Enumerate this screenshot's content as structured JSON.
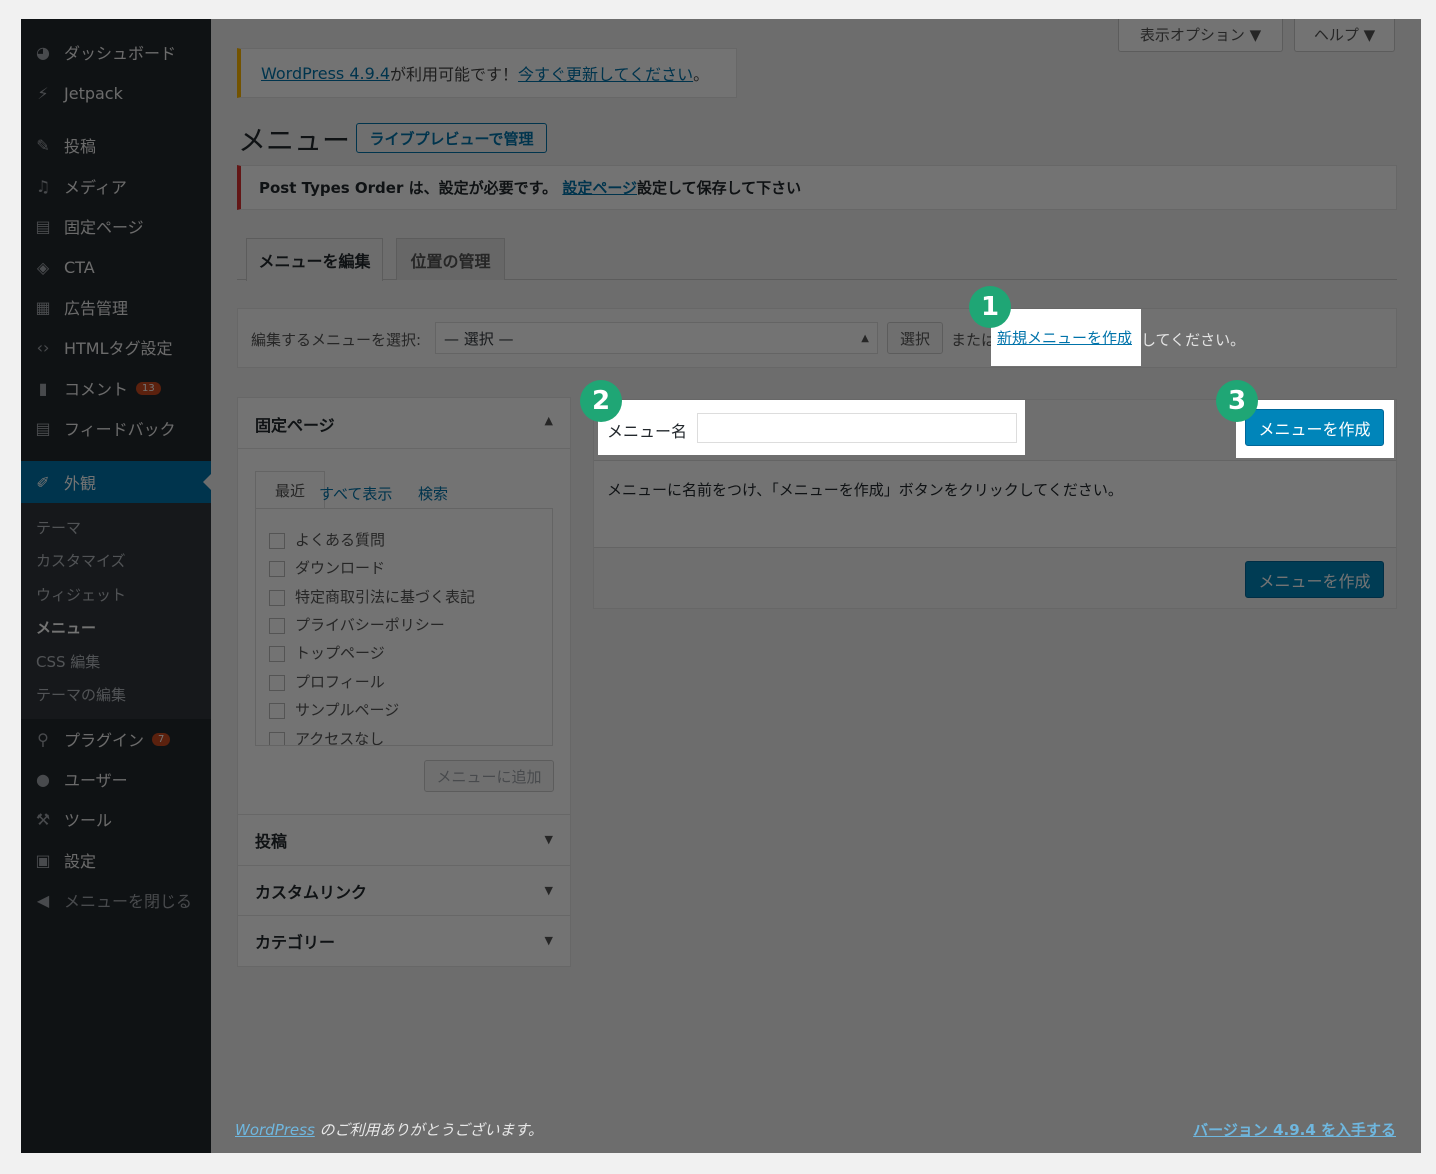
{
  "sidebar": {
    "dashboard": "ダッシュボード",
    "jetpack": "Jetpack",
    "posts": "投稿",
    "media": "メディア",
    "pages": "固定ページ",
    "cta": "CTA",
    "ads": "広告管理",
    "html_tags": "HTMLタグ設定",
    "comments": "コメント",
    "comments_count": "13",
    "feedback": "フィードバック",
    "appearance": "外観",
    "appearance_sub": {
      "themes": "テーマ",
      "customize": "カスタマイズ",
      "widgets": "ウィジェット",
      "menus": "メニュー",
      "css": "CSS 編集",
      "theme_editor": "テーマの編集"
    },
    "plugins": "プラグイン",
    "plugins_count": "7",
    "users": "ユーザー",
    "tools": "ツール",
    "settings": "設定",
    "collapse": "メニューを閉じる"
  },
  "screen_meta": {
    "options": "表示オプション ▼",
    "help": "ヘルプ ▼"
  },
  "notice_update": {
    "link": "WordPress 4.9.4",
    "text": " が利用可能です！",
    "action": "今すぐ更新してください",
    "suffix": "。"
  },
  "page": {
    "title": "メニュー",
    "live_preview": "ライブプレビューで管理"
  },
  "notice_error": {
    "text1": "Post Types Order は、設定が必要です。",
    "link": "設定ページ",
    "text2": " 設定して保存して下さい"
  },
  "tabs": {
    "edit": "メニューを編集",
    "locations": "位置の管理"
  },
  "select_bar": {
    "label": "編集するメニューを選択:",
    "selected": "— 選択 —",
    "select_button": "選択",
    "or": "または",
    "new_link": "新規メニューを作成",
    "suffix": "してください。"
  },
  "left_panel": {
    "pages_title": "固定ページ",
    "tab_recent": "最近",
    "tab_all": "すべて表示",
    "tab_search": "検索",
    "items": [
      "よくある質問",
      "ダウンロード",
      "特定商取引法に基づく表記",
      "プライバシーポリシー",
      "トップページ",
      "プロフィール",
      "サンプルページ",
      "アクセスなし"
    ],
    "add_button": "メニューに追加",
    "sections": [
      "投稿",
      "カスタムリンク",
      "カテゴリー"
    ]
  },
  "menu_editor": {
    "name_label": "メニュー名",
    "name_value": "",
    "create_button": "メニューを作成",
    "instructions": "メニューに名前をつけ、「メニューを作成」ボタンをクリックしてください。",
    "create_button_bottom": "メニューを作成"
  },
  "steps": [
    "1",
    "2",
    "3"
  ],
  "footer": {
    "wp_link": "WordPress",
    "thanks": " のご利用ありがとうございます。",
    "version": "バージョン 4.9.4 を入手する"
  },
  "colors": {
    "sidebar_bg": "#23282d",
    "active_bg": "#0073aa",
    "primary": "#0085ba",
    "step_green": "#1fa675",
    "badge": "#ca4a1f"
  }
}
